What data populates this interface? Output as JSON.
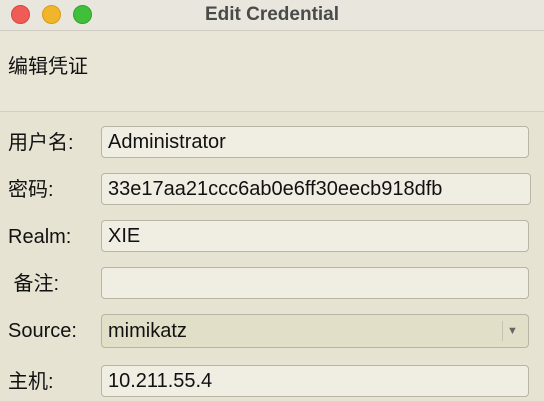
{
  "window": {
    "title": "Edit Credential"
  },
  "header": {
    "text": "编辑凭证"
  },
  "form": {
    "username_label": "用户名:",
    "username_value": "Administrator",
    "password_label": "密码:",
    "password_value": "33e17aa21ccc6ab0e6ff30eecb918dfb",
    "realm_label": "Realm:",
    "realm_value": "XIE",
    "note_label": " 备注:",
    "note_value": "",
    "source_label": "Source:",
    "source_value": "mimikatz",
    "host_label": "主机:",
    "host_value": "10.211.55.4"
  },
  "icons": {
    "close": "close-traffic-light",
    "minimize": "minimize-traffic-light",
    "maximize": "maximize-traffic-light",
    "dropdown": "chevron-down-icon"
  },
  "colors": {
    "close": "#ef5b55",
    "minimize": "#f0b52a",
    "maximize": "#3fbf3a",
    "window_bg": "#e7e3d3"
  }
}
